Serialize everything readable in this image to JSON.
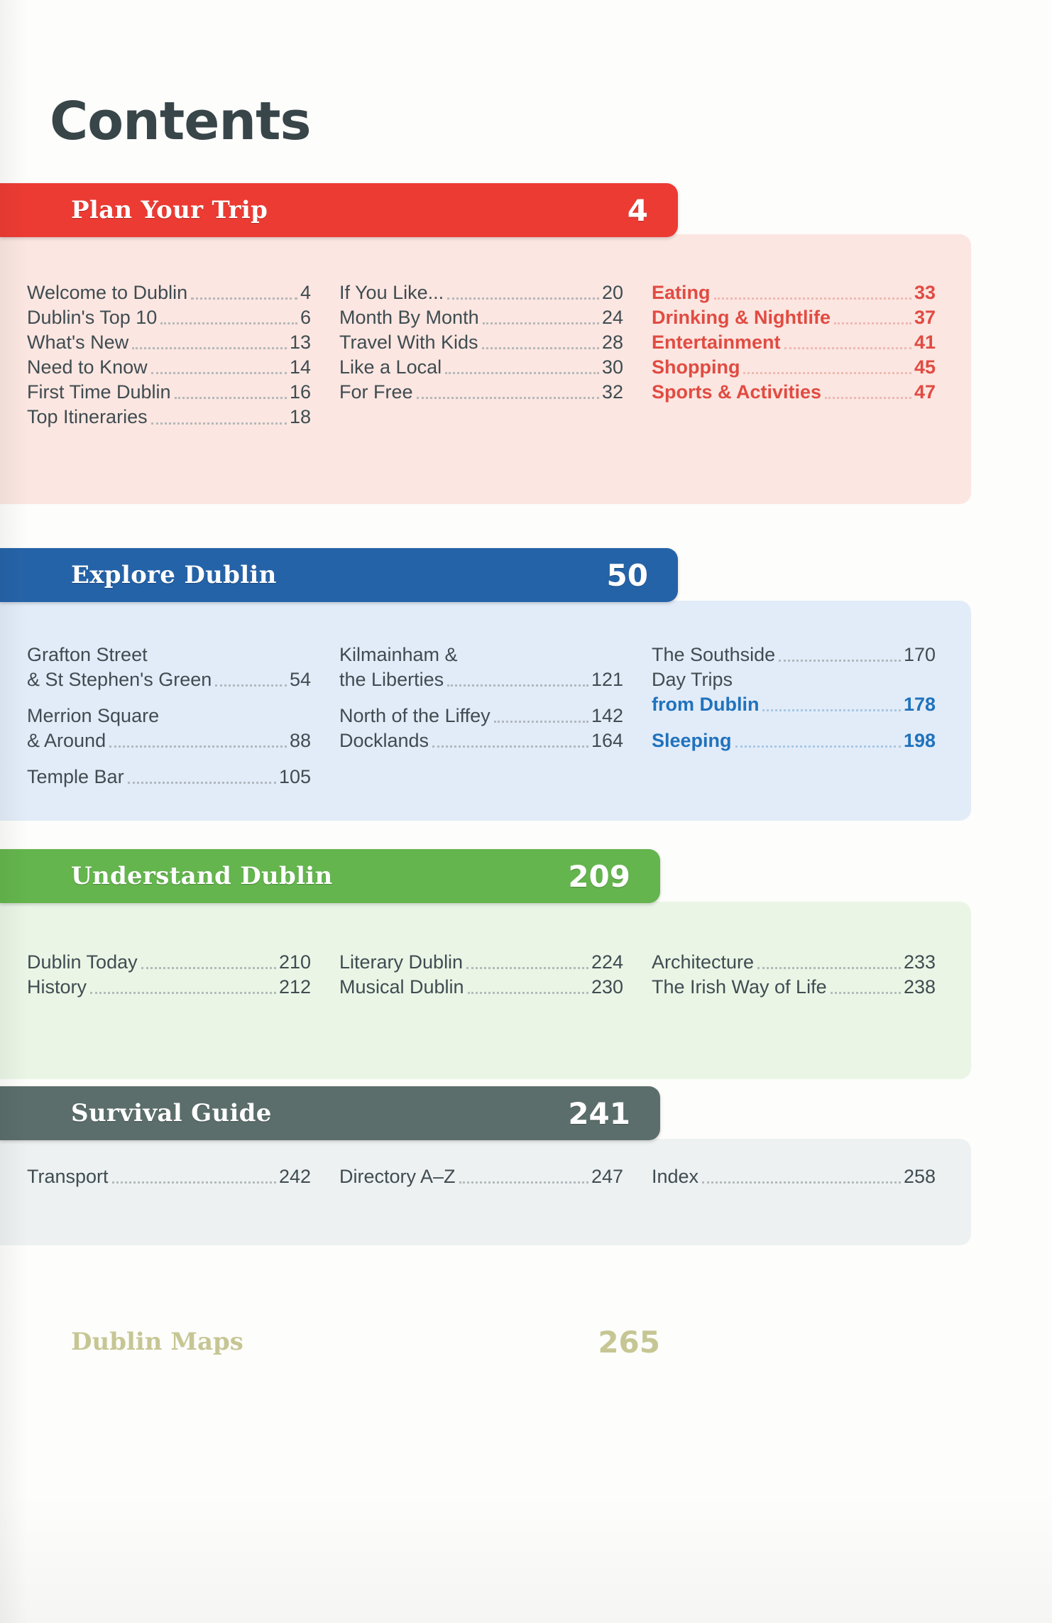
{
  "page": {
    "title": "Contents"
  },
  "sections": [
    {
      "id": "plan-your-trip",
      "title": "Plan Your Trip",
      "page": "4",
      "bar_color": "#ec3b33",
      "panel_color": "#fbe6e1",
      "columns": [
        {
          "style": "plain",
          "entries": [
            {
              "label": "Welcome to Dublin",
              "page": "4"
            },
            {
              "label": "Dublin's Top 10",
              "page": "6"
            },
            {
              "label": "What's New",
              "page": "13"
            },
            {
              "label": "Need to Know",
              "page": "14"
            },
            {
              "label": "First Time Dublin",
              "page": "16"
            },
            {
              "label": "Top Itineraries",
              "page": "18"
            }
          ]
        },
        {
          "style": "plain",
          "entries": [
            {
              "label": "If You Like...",
              "page": "20"
            },
            {
              "label": "Month By Month",
              "page": "24"
            },
            {
              "label": "Travel With Kids",
              "page": "28"
            },
            {
              "label": "Like a Local",
              "page": "30"
            },
            {
              "label": "For Free",
              "page": "32"
            }
          ]
        },
        {
          "style": "accent-red",
          "entries": [
            {
              "label": "Eating",
              "page": "33"
            },
            {
              "label": "Drinking & Nightlife",
              "page": "37"
            },
            {
              "label": "Entertainment",
              "page": "41"
            },
            {
              "label": "Shopping",
              "page": "45"
            },
            {
              "label": "Sports & Activities",
              "page": "47"
            }
          ]
        }
      ]
    },
    {
      "id": "explore-dublin",
      "title": "Explore Dublin",
      "page": "50",
      "bar_color": "#2563a8",
      "panel_color": "#e2ecf8",
      "columns": [
        {
          "style": "plain",
          "entries": [
            {
              "label": "Grafton Street",
              "label2": "& St Stephen's Green",
              "page": "54"
            },
            {
              "label": "Merrion Square",
              "label2": "& Around",
              "page": "88"
            },
            {
              "label": "Temple Bar",
              "page": "105"
            }
          ]
        },
        {
          "style": "plain",
          "entries": [
            {
              "label": "Kilmainham &",
              "label2": "the Liberties",
              "page": "121"
            },
            {
              "label": "North of the Liffey",
              "page": "142"
            },
            {
              "label": "Docklands",
              "page": "164"
            }
          ]
        },
        {
          "style": "mixed",
          "entries": [
            {
              "label": "The Southside",
              "page": "170",
              "style": "plain"
            },
            {
              "label": "Day Trips",
              "label2": "from Dublin",
              "page": "178",
              "style": "accent-blue"
            },
            {
              "label": "Sleeping",
              "page": "198",
              "style": "accent-blue"
            }
          ]
        }
      ]
    },
    {
      "id": "understand-dublin",
      "title": "Understand Dublin",
      "page": "209",
      "bar_color": "#64b54d",
      "panel_color": "#eaf5e6",
      "columns": [
        {
          "style": "plain",
          "entries": [
            {
              "label": "Dublin Today",
              "page": "210"
            },
            {
              "label": "History",
              "page": "212"
            }
          ]
        },
        {
          "style": "plain",
          "entries": [
            {
              "label": "Literary Dublin",
              "page": "224"
            },
            {
              "label": "Musical Dublin",
              "page": "230"
            }
          ]
        },
        {
          "style": "plain",
          "entries": [
            {
              "label": "Architecture",
              "page": "233"
            },
            {
              "label": "The Irish Way of Life",
              "page": "238"
            }
          ]
        }
      ]
    },
    {
      "id": "survival-guide",
      "title": "Survival Guide",
      "page": "241",
      "bar_color": "#5b6e6b",
      "panel_color": "#edf1f1",
      "columns": [
        {
          "style": "plain",
          "entries": [
            {
              "label": "Transport",
              "page": "242"
            }
          ]
        },
        {
          "style": "plain",
          "entries": [
            {
              "label": "Directory A–Z",
              "page": "247"
            }
          ]
        },
        {
          "style": "plain",
          "entries": [
            {
              "label": "Index",
              "page": "258"
            }
          ]
        }
      ]
    }
  ],
  "maps": {
    "title": "Dublin Maps",
    "page": "265",
    "color": "#bdbd84"
  }
}
